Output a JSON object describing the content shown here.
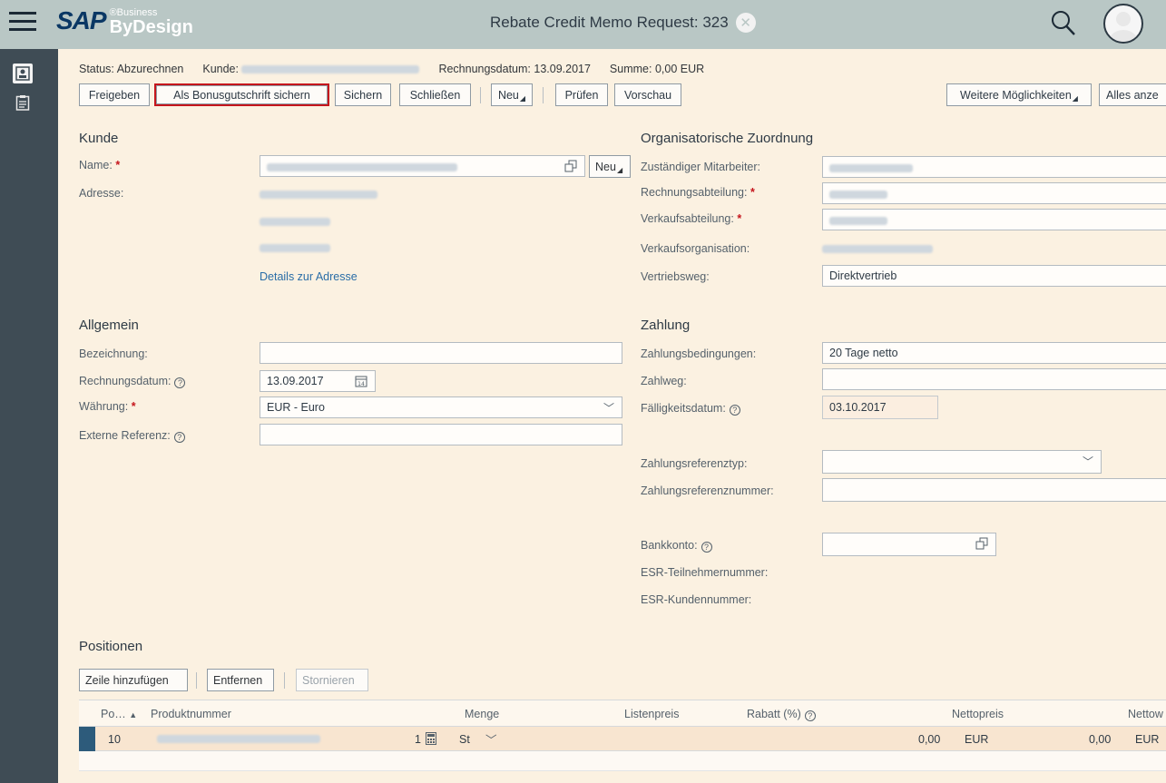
{
  "app": {
    "brand": "SAP",
    "brand_super": "®Business",
    "brand_product": "ByDesign",
    "title": "Rebate Credit Memo Request: 323"
  },
  "status_bar": {
    "status_label": "Status:",
    "status_value": "Abzurechnen",
    "customer_label": "Kunde:",
    "invoice_date_label": "Rechnungsdatum:",
    "invoice_date_value": "13.09.2017",
    "total_label": "Summe:",
    "total_value": "0,00 EUR"
  },
  "toolbar": {
    "release": "Freigeben",
    "save_as_bonus": "Als Bonusgutschrift sichern",
    "save": "Sichern",
    "close": "Schließen",
    "new": "Neu",
    "check": "Prüfen",
    "preview": "Vorschau",
    "more": "Weitere Möglichkeiten",
    "show_all": "Alles anze"
  },
  "kunde": {
    "title": "Kunde",
    "name_label": "Name:",
    "name_new": "Neu",
    "address_label": "Adresse:",
    "address_link": "Details zur Adresse"
  },
  "org": {
    "title": "Organisatorische Zuordnung",
    "employee_label": "Zuständiger Mitarbeiter:",
    "billing_dept_label": "Rechnungsabteilung:",
    "sales_dept_label": "Verkaufsabteilung:",
    "sales_org_label": "Verkaufsorganisation:",
    "channel_label": "Vertriebsweg:",
    "channel_value": "Direktvertrieb"
  },
  "allgemein": {
    "title": "Allgemein",
    "designation_label": "Bezeichnung:",
    "designation_value": "",
    "invoice_date_label": "Rechnungsdatum:",
    "invoice_date_value": "13.09.2017",
    "currency_label": "Währung:",
    "currency_value": "EUR - Euro",
    "external_ref_label": "Externe Referenz:",
    "external_ref_value": ""
  },
  "zahlung": {
    "title": "Zahlung",
    "terms_label": "Zahlungsbedingungen:",
    "terms_value": "20 Tage netto",
    "method_label": "Zahlweg:",
    "method_value": "",
    "due_label": "Fälligkeitsdatum:",
    "due_value": "03.10.2017",
    "ref_type_label": "Zahlungsreferenztyp:",
    "ref_type_value": "",
    "ref_number_label": "Zahlungsreferenznummer:",
    "ref_number_value": "",
    "bank_label": "Bankkonto:",
    "esr_participant_label": "ESR-Teilnehmernummer:",
    "esr_customer_label": "ESR-Kundennummer:"
  },
  "positionen": {
    "title": "Positionen",
    "add_row": "Zeile hinzufügen",
    "remove": "Entfernen",
    "cancel": "Stornieren",
    "columns": {
      "pos": "Po…",
      "product": "Produktnummer",
      "quantity": "Menge",
      "list_price": "Listenpreis",
      "discount": "Rabatt (%)",
      "net_price": "Nettopreis",
      "net_value": "Nettow"
    },
    "rows": [
      {
        "pos": "10",
        "qty": "1",
        "unit": "St",
        "net_price": "0,00",
        "currency": "EUR",
        "net_value": "0,00",
        "net_value_currency": "EUR"
      }
    ]
  },
  "colors": {
    "header_bg": "#b9c7c5",
    "rail_bg": "#3f4c55",
    "page_bg": "#fbf1e1",
    "highlight_border": "#c5151c",
    "required": "#c5151c",
    "link": "#2a6da7"
  }
}
